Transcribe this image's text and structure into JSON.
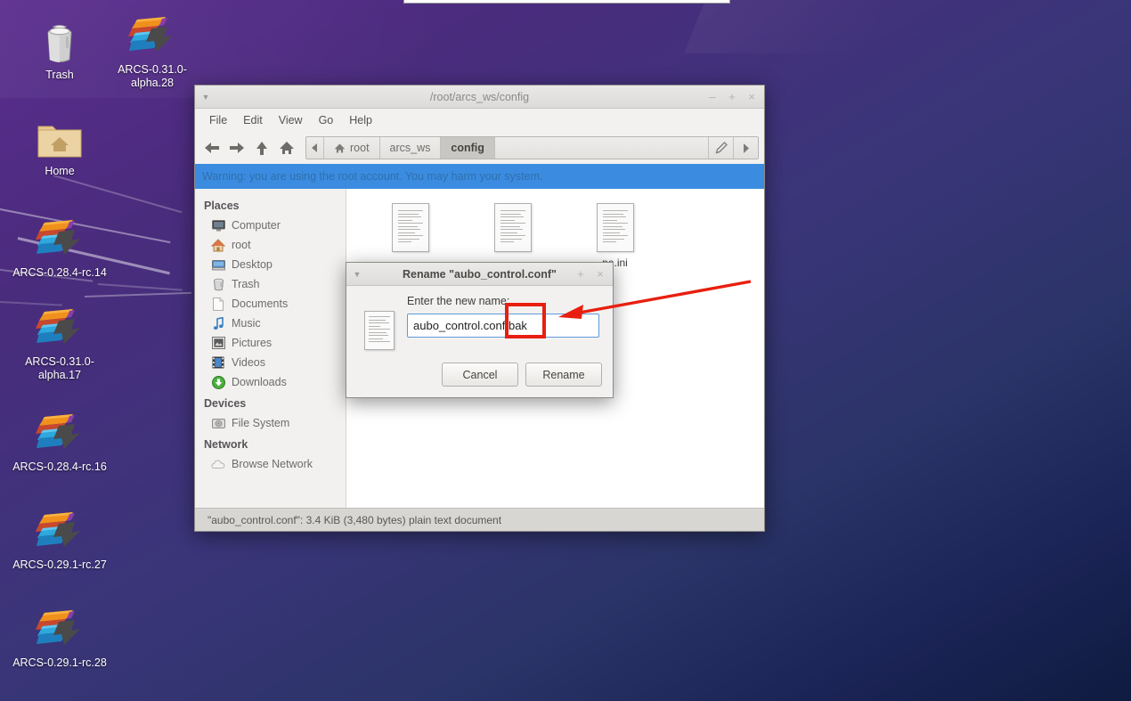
{
  "desktop": {
    "icons": [
      {
        "name": "Trash",
        "label": "Trash",
        "icon": "trash-icon"
      },
      {
        "name": "ARCS-0.31.0-alpha.28",
        "label": "ARCS-0.31.0-alpha.28",
        "icon": "arcs-app-icon"
      },
      {
        "name": "Home",
        "label": "Home",
        "icon": "home-folder-icon"
      },
      {
        "name": "ARCS-0.28.4-rc.14",
        "label": "ARCS-0.28.4-rc.14",
        "icon": "arcs-app-icon"
      },
      {
        "name": "ARCS-0.31.0-alpha.17",
        "label": "ARCS-0.31.0-alpha.17",
        "icon": "arcs-app-icon"
      },
      {
        "name": "ARCS-0.28.4-rc.16",
        "label": "ARCS-0.28.4-rc.16",
        "icon": "arcs-app-icon"
      },
      {
        "name": "ARCS-0.29.1-rc.27",
        "label": "ARCS-0.29.1-rc.27",
        "icon": "arcs-app-icon"
      },
      {
        "name": "ARCS-0.29.1-rc.28",
        "label": "ARCS-0.29.1-rc.28",
        "icon": "arcs-app-icon"
      }
    ],
    "wallpaper_colors": [
      "#5b2d8e",
      "#3b357a",
      "#0f1b40"
    ]
  },
  "file_manager": {
    "title": "/root/arcs_ws/config",
    "window_buttons": {
      "minimize": "–",
      "maximize": "+",
      "close": "×"
    },
    "menu": [
      "File",
      "Edit",
      "View",
      "Go",
      "Help"
    ],
    "nav_buttons": [
      "back-arrow",
      "forward-arrow",
      "up-arrow",
      "home"
    ],
    "breadcrumbs": [
      {
        "label": "root",
        "active": false,
        "icon": "home-icon"
      },
      {
        "label": "arcs_ws",
        "active": false
      },
      {
        "label": "config",
        "active": true
      }
    ],
    "path_tools": [
      "edit-path-pencil",
      "path-next-arrow"
    ],
    "warning": "Warning: you are using the root account. You may harm your system.",
    "warning_color": "#3b8ce0",
    "sidebar": {
      "sections": [
        {
          "heading": "Places",
          "items": [
            {
              "label": "Computer",
              "icon": "computer-icon"
            },
            {
              "label": "root",
              "icon": "home-icon"
            },
            {
              "label": "Desktop",
              "icon": "desktop-icon"
            },
            {
              "label": "Trash",
              "icon": "trash-icon"
            },
            {
              "label": "Documents",
              "icon": "document-icon"
            },
            {
              "label": "Music",
              "icon": "music-note-icon"
            },
            {
              "label": "Pictures",
              "icon": "pictures-icon"
            },
            {
              "label": "Videos",
              "icon": "video-icon"
            },
            {
              "label": "Downloads",
              "icon": "downloads-icon"
            }
          ]
        },
        {
          "heading": "Devices",
          "items": [
            {
              "label": "File System",
              "icon": "harddisk-icon"
            }
          ]
        },
        {
          "heading": "Network",
          "items": [
            {
              "label": "Browse Network",
              "icon": "network-cloud-icon"
            }
          ]
        }
      ]
    },
    "files": [
      {
        "label": "",
        "icon": "text-document-icon"
      },
      {
        "label": "",
        "icon": "text-document-icon"
      },
      {
        "label": "pe.ini",
        "icon": "text-document-icon"
      }
    ],
    "statusbar": "\"aubo_control.conf\": 3.4 KiB (3,480 bytes) plain text document"
  },
  "rename_dialog": {
    "title": "Rename \"aubo_control.conf\"",
    "window_buttons": {
      "maximize": "+",
      "close": "×"
    },
    "prompt": "Enter the new name:",
    "input_value": "aubo_control.conf.bak",
    "input_placeholder": "",
    "file_icon": "text-document-icon",
    "cancel_label": "Cancel",
    "rename_label": "Rename"
  },
  "annotations": {
    "highlight_color": "#e81f0f",
    "highlight_target": ".bak",
    "arrow_direction": "left"
  }
}
